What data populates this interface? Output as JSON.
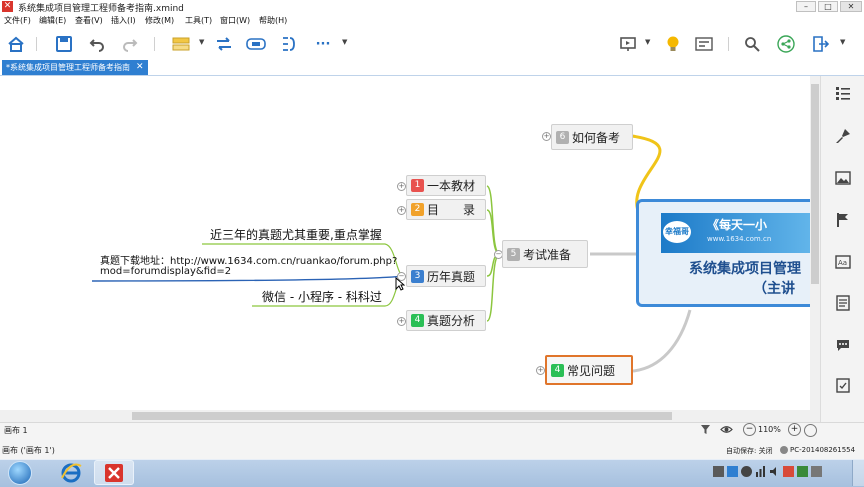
{
  "window": {
    "title": "系统集成项目管理工程师备考指南.xmind",
    "controls": {
      "minimize": "–",
      "maximize": "□",
      "close": "✕"
    }
  },
  "menu": [
    "文件(F)",
    "编辑(E)",
    "查看(V)",
    "插入(I)",
    "修改(M)",
    "工具(T)",
    "窗口(W)",
    "帮助(H)"
  ],
  "toolbar": {
    "icons": [
      "home-icon",
      "save-icon",
      "undo-icon",
      "redo-icon",
      "topic-style-icon",
      "relationship-icon",
      "boundary-icon",
      "summary-icon",
      "more-icon",
      "presentation-icon",
      "idea-icon",
      "layout-icon",
      "search-icon",
      "share-icon",
      "export-icon"
    ],
    "more_label": "···"
  },
  "tab": {
    "label": "*系统集成项目管理工程师备考指南",
    "close": "✕"
  },
  "mindmap": {
    "central": {
      "title_line1": "系统集成项目管理",
      "title_line2": "（主讲 ",
      "banner_logo": "幸福哥",
      "banner_text": "《每天一小",
      "banner_url": "www.1634.com.cn"
    },
    "branches": [
      {
        "num": "6",
        "label": "如何备考",
        "color": "#b0b0b0"
      },
      {
        "num": "5",
        "label": "考试准备",
        "color": "#b0b0b0"
      },
      {
        "num": "4",
        "label": "常见问题",
        "color": "#2bbf56"
      }
    ],
    "subtopics": [
      {
        "num": "1",
        "label": "一本教材",
        "color": "#e8524f"
      },
      {
        "num": "2",
        "label": "目　　录",
        "color": "#f1a22b"
      },
      {
        "num": "3",
        "label": "历年真题",
        "color": "#3b7fcf"
      },
      {
        "num": "4",
        "label": "真题分析",
        "color": "#2bbf56"
      }
    ],
    "notes": {
      "important": "近三年的真题尤其重要,重点掌握",
      "download_line1": "真题下载地址：http://www.1634.com.cn/ruankao/forum.php?",
      "download_line2": "mod=forumdisplay&fid=2",
      "wechat": "微信 - 小程序 - 科科过"
    }
  },
  "sheetbar": {
    "sheet": "画布 1",
    "zoom": "110%",
    "zoom_out": "−",
    "zoom_in": "+"
  },
  "statusbar": {
    "left": "画布 ('画布 1')",
    "autosave": "自动保存: 关闭",
    "pc": "PC-201408261554"
  },
  "colors": {
    "accent": "#2f7fd1",
    "central_border": "#3d8ad8",
    "line_yellow": "#f0c419",
    "line_grey": "#bdbdbd",
    "line_green": "#8cc63f"
  }
}
